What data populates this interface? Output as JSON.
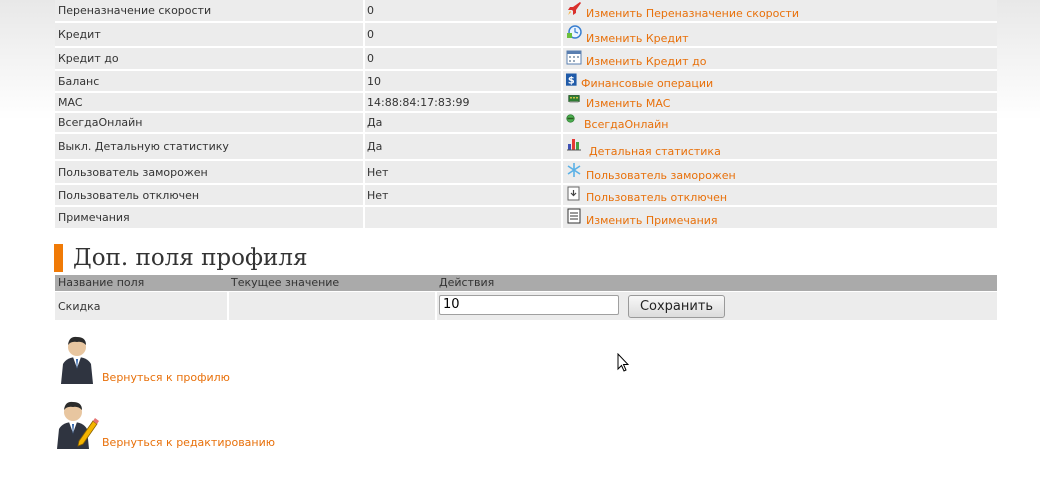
{
  "props_rows": [
    {
      "label": "Переназначение скорости",
      "value": "0",
      "icon": "rocket-icon",
      "link": "Изменить Переназначение скорости"
    },
    {
      "label": "Кредит",
      "value": "0",
      "icon": "credit-clock-icon",
      "link": "Изменить Кредит"
    },
    {
      "label": "Кредит до",
      "value": "0",
      "icon": "calendar-icon",
      "link": "Изменить Кредит до"
    },
    {
      "label": "Баланс",
      "value": "10",
      "icon": "dollar-icon",
      "link": "Финансовые операции"
    },
    {
      "label": "MAC",
      "value": "14:88:84:17:83:99",
      "icon": "network-card-icon",
      "link": "Изменить MAC"
    },
    {
      "label": "ВсегдаОнлайн",
      "value": "Да",
      "icon": "online-status-icon",
      "link": "ВсегдаОнлайн"
    },
    {
      "label": "Выкл. Детальную статистику",
      "value": "Да",
      "icon": "bar-chart-icon",
      "link": "Детальная статистика"
    },
    {
      "label": "Пользователь заморожен",
      "value": "Нет",
      "icon": "snowflake-icon",
      "link": "Пользователь заморожен"
    },
    {
      "label": "Пользователь отключен",
      "value": "Нет",
      "icon": "power-icon",
      "link": "Пользователь отключен"
    },
    {
      "label": "Примечания",
      "value": "",
      "icon": "notes-icon",
      "link": "Изменить Примечания"
    }
  ],
  "section": {
    "title": "Доп. поля профиля"
  },
  "extra_fields": {
    "headers": {
      "name": "Название поля",
      "current": "Текущее значение",
      "actions": "Действия"
    },
    "row": {
      "name": "Скидка",
      "current": "",
      "input_value": "10",
      "save_label": "Сохранить"
    }
  },
  "back_links": {
    "profile": "Вернуться к профилю",
    "edit": "Вернуться к редактированию"
  },
  "colors": {
    "accent": "#f07a06",
    "link": "#e8700a",
    "row_bg": "#ececec",
    "header_bg": "#aaaaaa"
  }
}
